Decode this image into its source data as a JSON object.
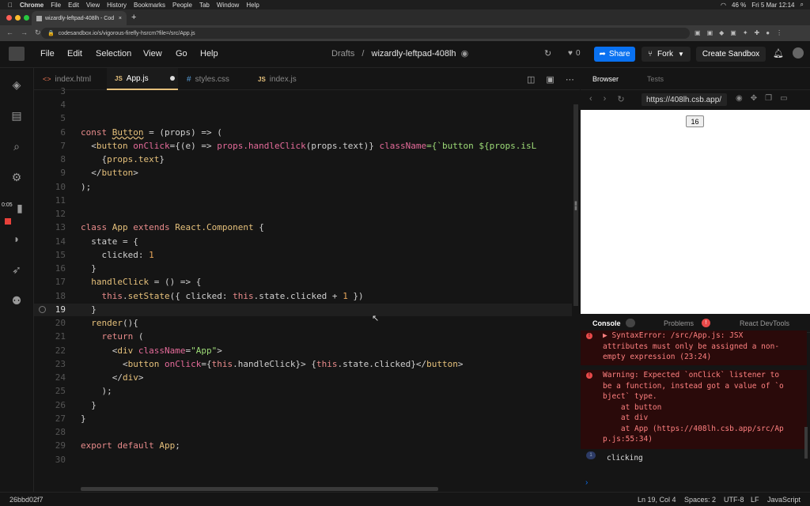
{
  "mac_menu": {
    "app": "Chrome",
    "items": [
      "File",
      "Edit",
      "View",
      "History",
      "Bookmarks",
      "People",
      "Tab",
      "Window",
      "Help"
    ],
    "battery": "46 %",
    "datetime": "Fri 5 Mar  12:14"
  },
  "browser": {
    "tab_title": "wizardly-leftpad-408lh - Cod",
    "url": "codesandbox.io/s/vigorous-firefly-hsrcm?file=/src/App.js"
  },
  "csb_header": {
    "menu": [
      "File",
      "Edit",
      "Selection",
      "View",
      "Go",
      "Help"
    ],
    "breadcrumb_folder": "Drafts",
    "breadcrumb_sep": "/",
    "sandbox_name": "wizardly-leftpad-408lh",
    "likes": "0",
    "share_label": "Share",
    "fork_label": "Fork",
    "create_label": "Create Sandbox"
  },
  "sidebar": {
    "timer": "0:05"
  },
  "editor_tabs": [
    {
      "label": "index.html",
      "icon": "<>",
      "icon_color": "#e57250"
    },
    {
      "label": "App.js",
      "icon": "JS",
      "icon_color": "#e5c07b"
    },
    {
      "label": "styles.css",
      "icon": "#",
      "icon_color": "#569cd6"
    },
    {
      "label": "index.js",
      "icon": "JS",
      "icon_color": "#e5c07b"
    }
  ],
  "line_numbers": [
    "3",
    "4",
    "5",
    "6",
    "7",
    "8",
    "9",
    "10",
    "11",
    "12",
    "13",
    "14",
    "15",
    "16",
    "17",
    "18",
    "19",
    "20",
    "21",
    "22",
    "23",
    "24",
    "25",
    "26",
    "27",
    "28",
    "29",
    "30"
  ],
  "code": {
    "l6a": "const ",
    "l6b": "Button",
    "l6c": " = (props) => (",
    "l7a": "  <",
    "l7b": "button ",
    "l7c": "onClick",
    "l7d": "={(e) => ",
    "l7e": "props.handleClick",
    "l7f": "(props.text)} ",
    "l7g": "className",
    "l7h": "={`button ${props.isL",
    "l8a": "    {",
    "l8b": "props.text",
    "l8c": "}",
    "l9a": "  </",
    "l9b": "button",
    "l9c": ">",
    "l10": ");",
    "l13a": "class ",
    "l13b": "App ",
    "l13c": "extends ",
    "l13d": "React.Component",
    " l13e": "",
    "l13f": " {",
    "l14a": "  state = {",
    "l15a": "    clicked: ",
    "l15b": "1",
    "l16": "  }",
    "l17a": "  ",
    "l17b": "handleClick",
    " l17c": "",
    "l17d": " = () => {",
    "l18a": "    ",
    "l18b": "this",
    ".": "",
    "l18c": ".",
    "l18d": "setState",
    "l18e": "({ clicked: ",
    "l18f": "this",
    "l18g": ".state.clicked + ",
    "l18h": "1",
    " l18i": "",
    "l18j": " })",
    "l19": "  }",
    "l20a": "  ",
    "l20b": "render",
    "l20c": "(){",
    "l21a": "    ",
    "l21b": "return",
    " l21c": "",
    "l21d": " (",
    "l22a": "      <",
    "l22b": "div ",
    "l22c": "className",
    "l22d": "=",
    "l22e": "\"App\"",
    "l22f": ">",
    "l23a": "        <",
    "l23b": "button ",
    "l23c": "onClick",
    "l23d": "={",
    "l23e": "this",
    "l23f": ".handleClick}> {",
    "l23g": "this",
    "l23h": ".state.clicked}</",
    "l23i": "button",
    "l23j": ">",
    "l24a": "      </",
    "l24b": "div",
    "l24c": ">",
    "l25": "    );",
    "l26": "  }",
    "l27": "}",
    "l29a": "export ",
    "l29b": "default ",
    "l29c": "App",
    ";": "",
    "l29d": ";"
  },
  "right_panel": {
    "tab_browser": "Browser",
    "tab_tests": "Tests",
    "preview_url": "https://408lh.csb.app/",
    "preview_button": "16"
  },
  "console": {
    "tab_console": "Console",
    "tab_problems": "Problems",
    "tab_devtools": "React DevTools",
    "error1": "▶ SyntaxError: /src/App.js: JSX\nattributes must only be assigned a non-\nempty expression (23:24)",
    "error2": "Warning: Expected `onClick` listener to\nbe a function, instead got a value of `o\nbject` type.\n    at button\n    at div\n    at App (https://408lh.csb.app/src/Ap\np.js:55:34)",
    "log1": "clicking",
    "prompt": "›"
  },
  "status": {
    "commit": "26bbd02f7",
    "position": "Ln 19, Col 4",
    "spaces": "Spaces: 2",
    "encoding": "UTF-8",
    "eol": "LF",
    "language": "JavaScript"
  }
}
